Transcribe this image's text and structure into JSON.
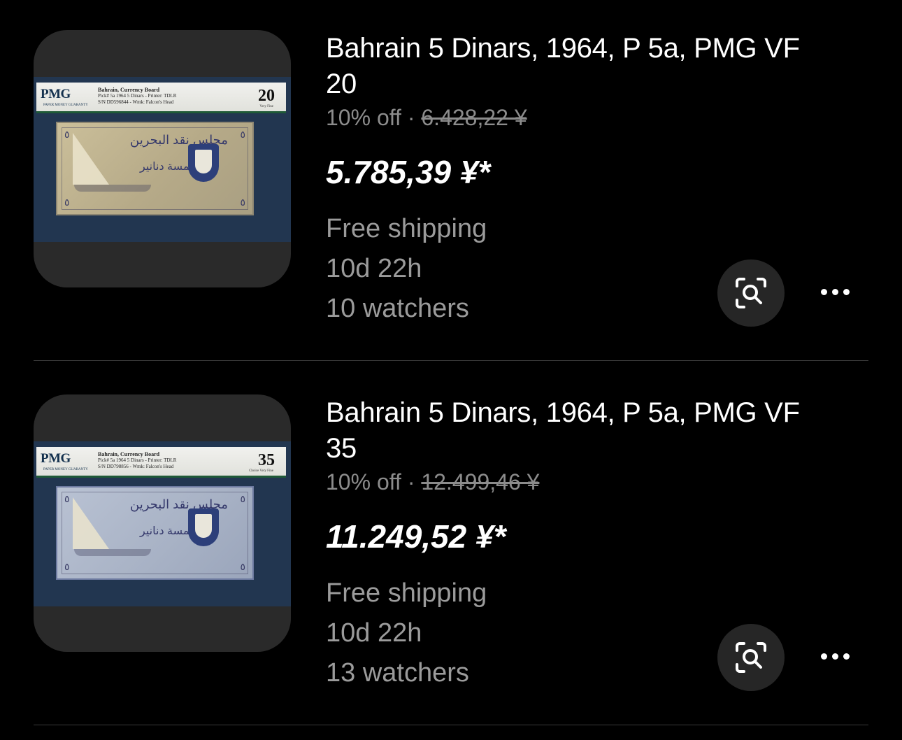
{
  "listings": [
    {
      "title": "Bahrain 5 Dinars, 1964, P 5a, PMG VF 20",
      "discount": "10% off",
      "separator": "·",
      "original_price": "6.428,22 ¥",
      "price": "5.785,39 ¥*",
      "shipping": "Free shipping",
      "time_left": "10d 22h",
      "watchers": "10 watchers",
      "slab": {
        "logo": "PMG",
        "logo_sub": "PAPER MONEY GUARANTY",
        "line1": "Bahrain, Currency Board",
        "line2": "Pick# 5a  1964  5 Dinars - Printer: TDLR",
        "line3": "S/N DD596844 - Wmk: Falcon's Head",
        "grade": "20",
        "grade_sub": "Very Fine"
      }
    },
    {
      "title": "Bahrain 5 Dinars, 1964, P 5a, PMG VF 35",
      "discount": "10% off",
      "separator": "·",
      "original_price": "12.499,46 ¥",
      "price": "11.249,52 ¥*",
      "shipping": "Free shipping",
      "time_left": "10d 22h",
      "watchers": "13 watchers",
      "slab": {
        "logo": "PMG",
        "logo_sub": "PAPER MONEY GUARANTY",
        "line1": "Bahrain, Currency Board",
        "line2": "Pick# 5a  1964  5 Dinars - Printer: TDLR",
        "line3": "S/N DD798856 - Wmk: Falcon's Head",
        "grade": "35",
        "grade_sub": "Choice Very Fine"
      }
    }
  ],
  "banknote_text": {
    "script_top": "مجلس نقد البحرين",
    "script_value": "خمسة دنانير",
    "corner_number": "٥"
  },
  "icons": {
    "visual_search": "visual-search-icon",
    "more": "more-options-icon"
  }
}
